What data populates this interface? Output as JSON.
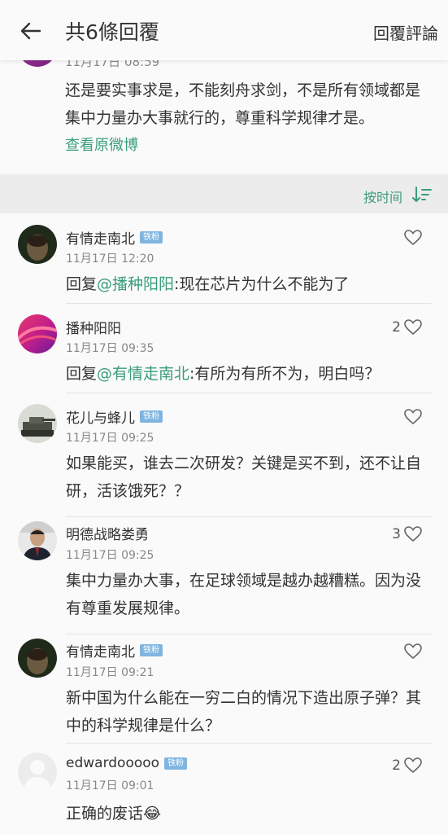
{
  "header": {
    "title": "共6條回覆",
    "action_label": "回覆評論"
  },
  "post": {
    "time": "11月17日 08:59",
    "text": "还是要实事求是，不能刻舟求剑，不是所有领域都是集中力量办大事就行的，尊重科学规律才是。",
    "link_label": "查看原微博"
  },
  "sort": {
    "label": "按时间"
  },
  "badge_label": "铁粉",
  "comments": [
    {
      "name": "有情走南北",
      "badge": true,
      "time": "11月17日 12:20",
      "prefix": "回复",
      "mention": "@播种阳阳",
      "body": ":现在芯片为什么不能为了",
      "likes": ""
    },
    {
      "name": "播种阳阳",
      "badge": false,
      "time": "11月17日 09:35",
      "prefix": "回复",
      "mention": "@有情走南北",
      "body": ":有所为有所不为，明白吗？",
      "likes": "2"
    },
    {
      "name": "花儿与蜂儿",
      "badge": true,
      "time": "11月17日 09:25",
      "body": "如果能买，谁去二次研发？关键是买不到，还不让自研，活该饿死？？",
      "likes": ""
    },
    {
      "name": "明德战略娄勇",
      "badge": false,
      "time": "11月17日 09:25",
      "body": "集中力量办大事，在足球领域是越办越糟糕。因为没有尊重发展规律。",
      "likes": "3"
    },
    {
      "name": "有情走南北",
      "badge": true,
      "time": "11月17日 09:21",
      "body": "新中国为什么能在一穷二白的情况下造出原子弹？其中的科学规律是什么？",
      "likes": ""
    },
    {
      "name": "edwardooooo",
      "badge": true,
      "time": "11月17日 09:01",
      "body": "正确的废话",
      "emoji": "😂",
      "likes": "2"
    }
  ],
  "colors": {
    "accent": "#3a9d7a",
    "badge": "#7fb4e0",
    "sortbar": "#ececec"
  }
}
